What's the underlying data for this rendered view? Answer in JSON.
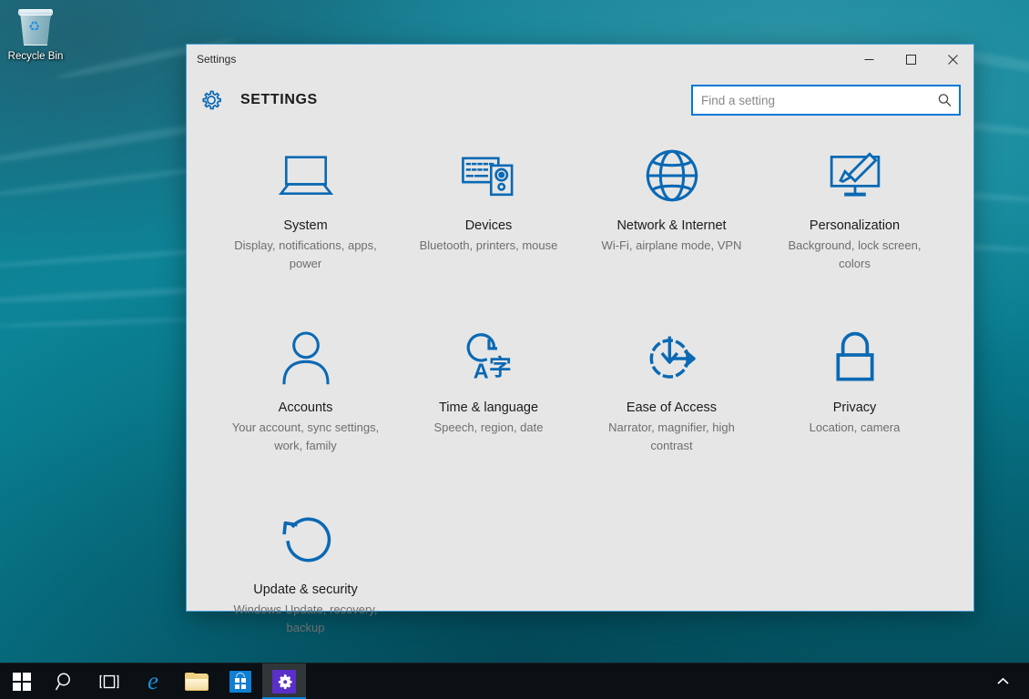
{
  "desktop": {
    "recycle_bin": {
      "label": "Recycle Bin",
      "icon": "recycle-bin-icon"
    },
    "wallpaper_color": "#0a8698"
  },
  "window": {
    "titlebar_text": "Settings",
    "controls": {
      "minimize": "Minimize",
      "maximize": "Maximize",
      "close": "Close"
    },
    "header": {
      "gear_icon": "gear-icon",
      "title": "SETTINGS"
    },
    "search": {
      "placeholder": "Find a setting",
      "value": "",
      "icon": "search-icon",
      "focus_color": "#0078d7"
    },
    "accent_color": "#0a69b4",
    "background_color": "#e6e6e6"
  },
  "tiles": [
    {
      "title": "System",
      "desc": "Display, notifications, apps, power",
      "icon": "laptop-icon"
    },
    {
      "title": "Devices",
      "desc": "Bluetooth, printers, mouse",
      "icon": "keyboard-device-icon"
    },
    {
      "title": "Network & Internet",
      "desc": "Wi-Fi, airplane mode, VPN",
      "icon": "globe-icon"
    },
    {
      "title": "Personalization",
      "desc": "Background, lock screen, colors",
      "icon": "monitor-paintbrush-icon"
    },
    {
      "title": "Accounts",
      "desc": "Your account, sync settings, work, family",
      "icon": "person-icon"
    },
    {
      "title": "Time & language",
      "desc": "Speech, region, date",
      "icon": "clock-language-icon"
    },
    {
      "title": "Ease of Access",
      "desc": "Narrator, magnifier, high contrast",
      "icon": "accessibility-circle-arrows-icon"
    },
    {
      "title": "Privacy",
      "desc": "Location, camera",
      "icon": "padlock-icon"
    },
    {
      "title": "Update & security",
      "desc": "Windows Update, recovery, backup",
      "icon": "refresh-circle-icon"
    }
  ],
  "taskbar": {
    "background_color": "#0a1014",
    "items": [
      {
        "name": "start",
        "label": "Start",
        "icon": "windows-logo-icon",
        "active": false
      },
      {
        "name": "search",
        "label": "Search",
        "icon": "search-icon",
        "active": false
      },
      {
        "name": "task-view",
        "label": "Task View",
        "icon": "task-view-icon",
        "active": false
      },
      {
        "name": "edge",
        "label": "Microsoft Edge",
        "icon": "edge-icon",
        "active": false
      },
      {
        "name": "file-explorer",
        "label": "File Explorer",
        "icon": "folder-icon",
        "active": false
      },
      {
        "name": "store",
        "label": "Store",
        "icon": "store-icon",
        "active": false
      },
      {
        "name": "settings",
        "label": "Settings",
        "icon": "gear-icon",
        "active": true
      }
    ],
    "tray": {
      "show_hidden_icons": "Show hidden icons",
      "icon": "chevron-up-icon"
    }
  }
}
